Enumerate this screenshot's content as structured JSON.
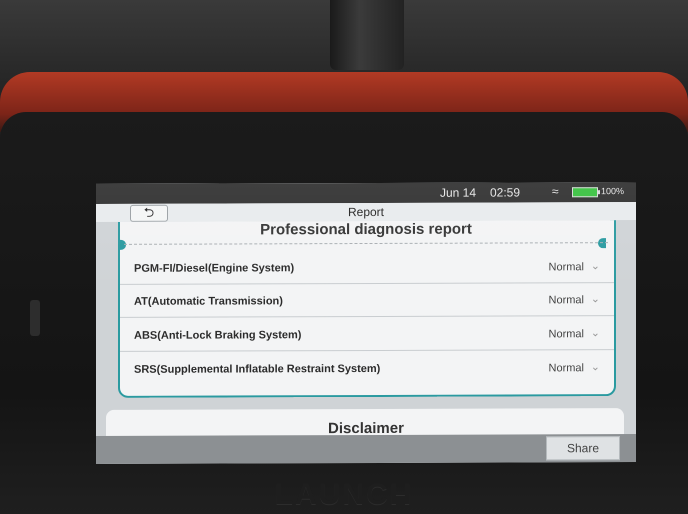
{
  "status_bar": {
    "date": "Jun 14",
    "time": "02:59",
    "battery": "100%"
  },
  "header": {
    "back_symbol": "⮌",
    "title": "Report"
  },
  "report": {
    "title": "Professional diagnosis report",
    "rows": [
      {
        "system": "PGM-FI/Diesel(Engine System)",
        "status": "Normal"
      },
      {
        "system": "AT(Automatic Transmission)",
        "status": "Normal"
      },
      {
        "system": "ABS(Anti-Lock Braking System)",
        "status": "Normal"
      },
      {
        "system": "SRS(Supplemental Inflatable Restraint System)",
        "status": "Normal"
      }
    ]
  },
  "disclaimer": {
    "title": "Disclaimer"
  },
  "footer": {
    "share_label": "Share"
  },
  "device": {
    "brand": "LAUNCH"
  },
  "colors": {
    "accent": "#2a9aa0",
    "battery": "#37c23e"
  }
}
